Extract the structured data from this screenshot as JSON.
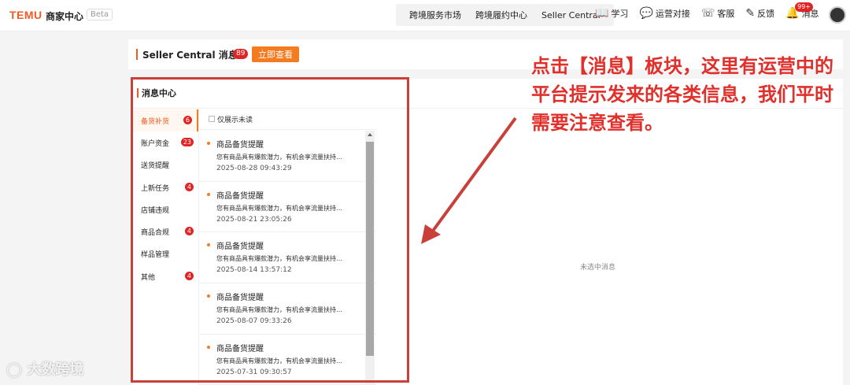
{
  "topbar": {
    "logo": "TEMU",
    "title": "商家中心",
    "beta": "Beta",
    "nav": [
      "跨境服务市场",
      "跨境履约中心",
      "Seller Central"
    ],
    "icons": [
      {
        "label": "学习",
        "icon": "book-icon"
      },
      {
        "label": "运营对接",
        "icon": "chat-icon"
      },
      {
        "label": "客服",
        "icon": "headset-icon"
      },
      {
        "label": "反馈",
        "icon": "feedback-icon"
      },
      {
        "label": "消息",
        "icon": "bell-icon",
        "badge": "99+"
      }
    ]
  },
  "header": {
    "title": "Seller Central 消息",
    "badge": "89",
    "button": "立即查看"
  },
  "message_center": {
    "title": "消息中心",
    "filter_label": "仅展示未读",
    "sidebar": [
      {
        "label": "备货补货",
        "badge": "6",
        "active": true
      },
      {
        "label": "账户资金",
        "badge": "23"
      },
      {
        "label": "送货提醒",
        "badge": ""
      },
      {
        "label": "上新任务",
        "badge": "4"
      },
      {
        "label": "店铺违规",
        "badge": ""
      },
      {
        "label": "商品合规",
        "badge": "4"
      },
      {
        "label": "样品管理",
        "badge": ""
      },
      {
        "label": "其他",
        "badge": "4"
      }
    ],
    "messages": [
      {
        "title": "商品备货提醒",
        "body": "您有商品具有爆款潜力，有机会享流量扶持…",
        "time": "2025-08-28 09:43:29"
      },
      {
        "title": "商品备货提醒",
        "body": "您有商品具有爆款潜力，有机会享流量扶持…",
        "time": "2025-08-21 23:05:26"
      },
      {
        "title": "商品备货提醒",
        "body": "您有商品具有爆款潜力，有机会享流量扶持…",
        "time": "2025-08-14 13:57:12"
      },
      {
        "title": "商品备货提醒",
        "body": "您有商品具有爆款潜力，有机会享流量扶持…",
        "time": "2025-08-07 09:33:26"
      },
      {
        "title": "商品备货提醒",
        "body": "您有商品具有爆款潜力，有机会享流量扶持…",
        "time": "2025-07-31 09:30:57"
      }
    ],
    "empty_text": "未选中消息"
  },
  "annotation": "点击【消息】板块，这里有运营中的平台提示发来的各类信息，我们平时需要注意查看。",
  "watermark": "大数跨境",
  "colors": {
    "brand": "#f15a22",
    "accent": "#f47b20",
    "badge": "#e02424",
    "annotation": "#e0302c"
  }
}
